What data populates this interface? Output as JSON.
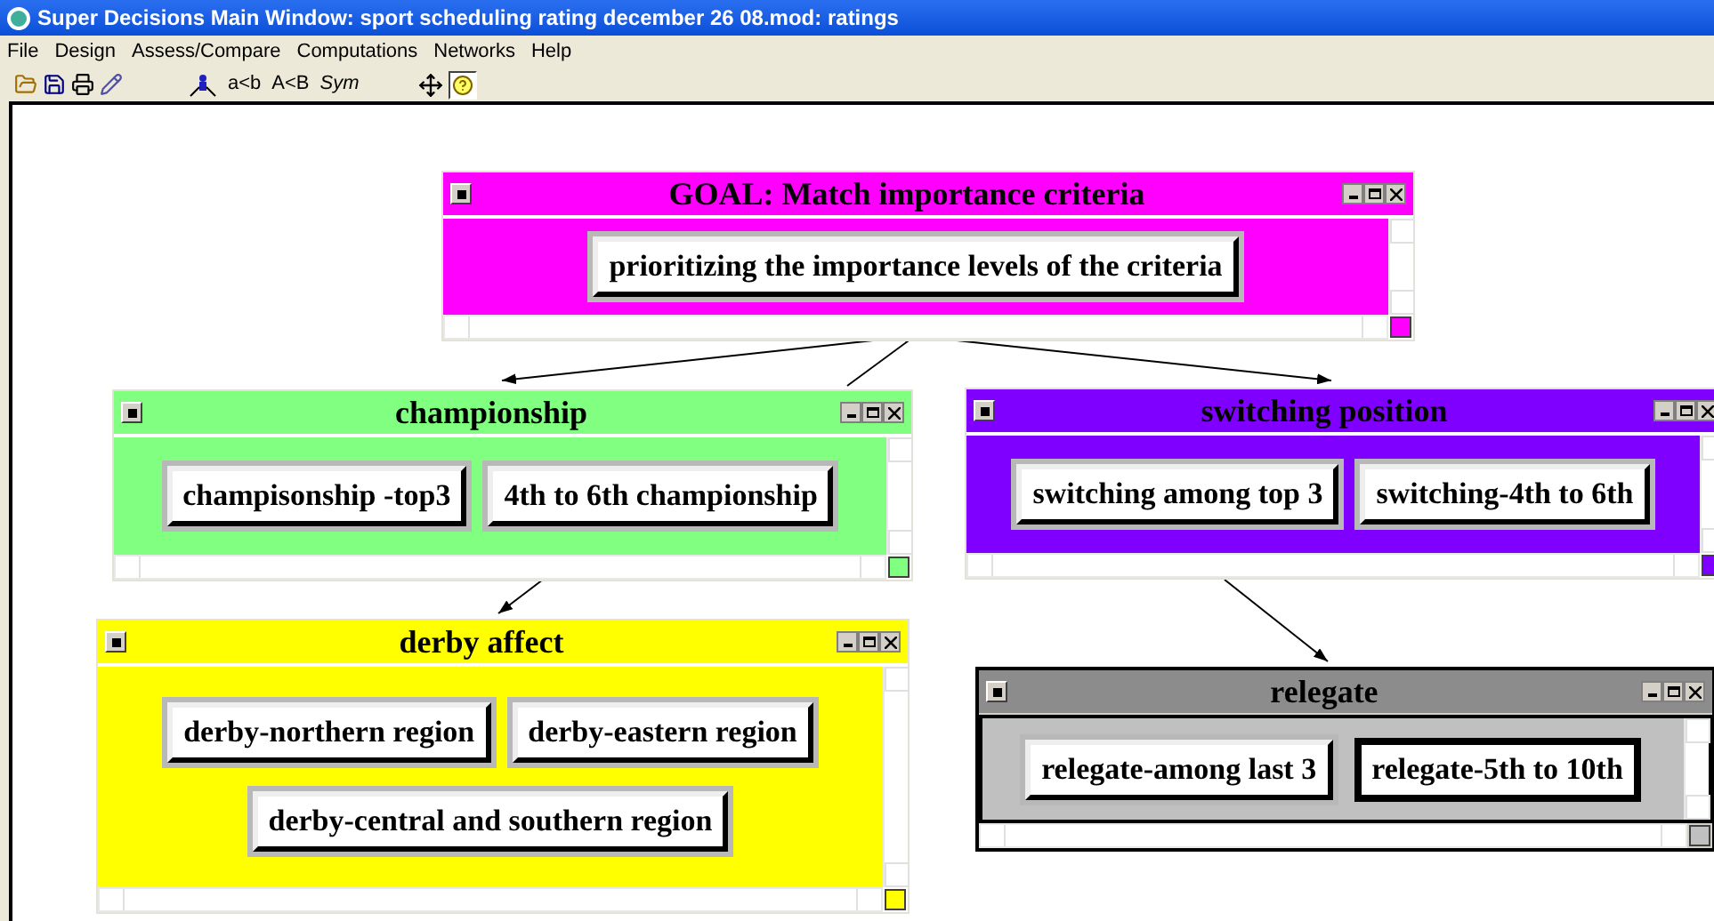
{
  "window": {
    "title": "Super Decisions Main Window: sport scheduling rating december 26 08.mod: ratings"
  },
  "menu": [
    "File",
    "Design",
    "Assess/Compare",
    "Computations",
    "Networks",
    "Help"
  ],
  "toolbar": {
    "compare_labels": [
      "a<b",
      "A<B",
      "Sym"
    ],
    "help_pressed": true
  },
  "clusters": [
    {
      "title": "GOAL: Match importance criteria",
      "color": "#ff00ff",
      "selected": false,
      "nodes": [
        {
          "label": "prioritizing the importance levels of the criteria",
          "selected": false
        }
      ]
    },
    {
      "title": "championship",
      "color": "#80ff80",
      "selected": false,
      "nodes": [
        {
          "label": "champisonship -top3",
          "selected": false
        },
        {
          "label": "4th to 6th championship",
          "selected": false
        }
      ]
    },
    {
      "title": "switching position",
      "color": "#8000ff",
      "selected": false,
      "nodes": [
        {
          "label": "switching among top 3",
          "selected": false
        },
        {
          "label": "switching-4th to 6th",
          "selected": false
        }
      ]
    },
    {
      "title": "derby affect",
      "color": "#ffff00",
      "selected": false,
      "nodes": [
        {
          "label": "derby-northern region",
          "selected": false
        },
        {
          "label": "derby-eastern region",
          "selected": false
        },
        {
          "label": "derby-central and southern region",
          "selected": false
        }
      ]
    },
    {
      "title": "relegate",
      "color": "#c0c0c0",
      "selected": true,
      "nodes": [
        {
          "label": "relegate-among last 3",
          "selected": false
        },
        {
          "label": "relegate-5th to 10th",
          "selected": true
        }
      ]
    }
  ]
}
